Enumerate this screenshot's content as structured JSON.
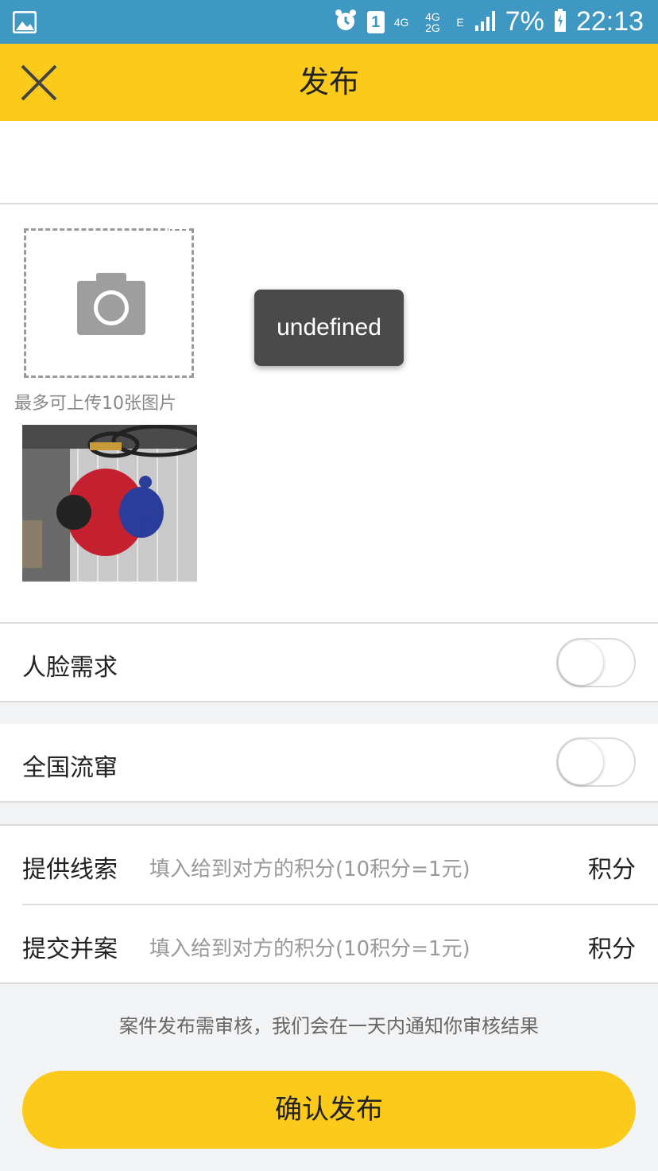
{
  "status_bar": {
    "sim": "1",
    "network_top": "4G",
    "network_stack": "4G 2G",
    "data_type": "E",
    "battery": "7%",
    "time": "22:13"
  },
  "header": {
    "title": "发布",
    "close_icon": "close-icon"
  },
  "photos": {
    "upload_hint": "最多可上传10张图片",
    "camera_icon": "camera-icon"
  },
  "toast": "undefined",
  "options": [
    {
      "label": "人脸需求",
      "enabled": false
    },
    {
      "label": "全国流窜",
      "enabled": false
    }
  ],
  "rewards": [
    {
      "label": "提供线索",
      "placeholder": "填入给到对方的积分(10积分=1元)",
      "unit": "积分"
    },
    {
      "label": "提交并案",
      "placeholder": "填入给到对方的积分(10积分=1元)",
      "unit": "积分"
    }
  ],
  "notice": "案件发布需审核，我们会在一天内通知你审核结果",
  "confirm_label": "确认发布",
  "colors": {
    "accent": "#fbca1a",
    "status_bar": "#3f98c2"
  }
}
